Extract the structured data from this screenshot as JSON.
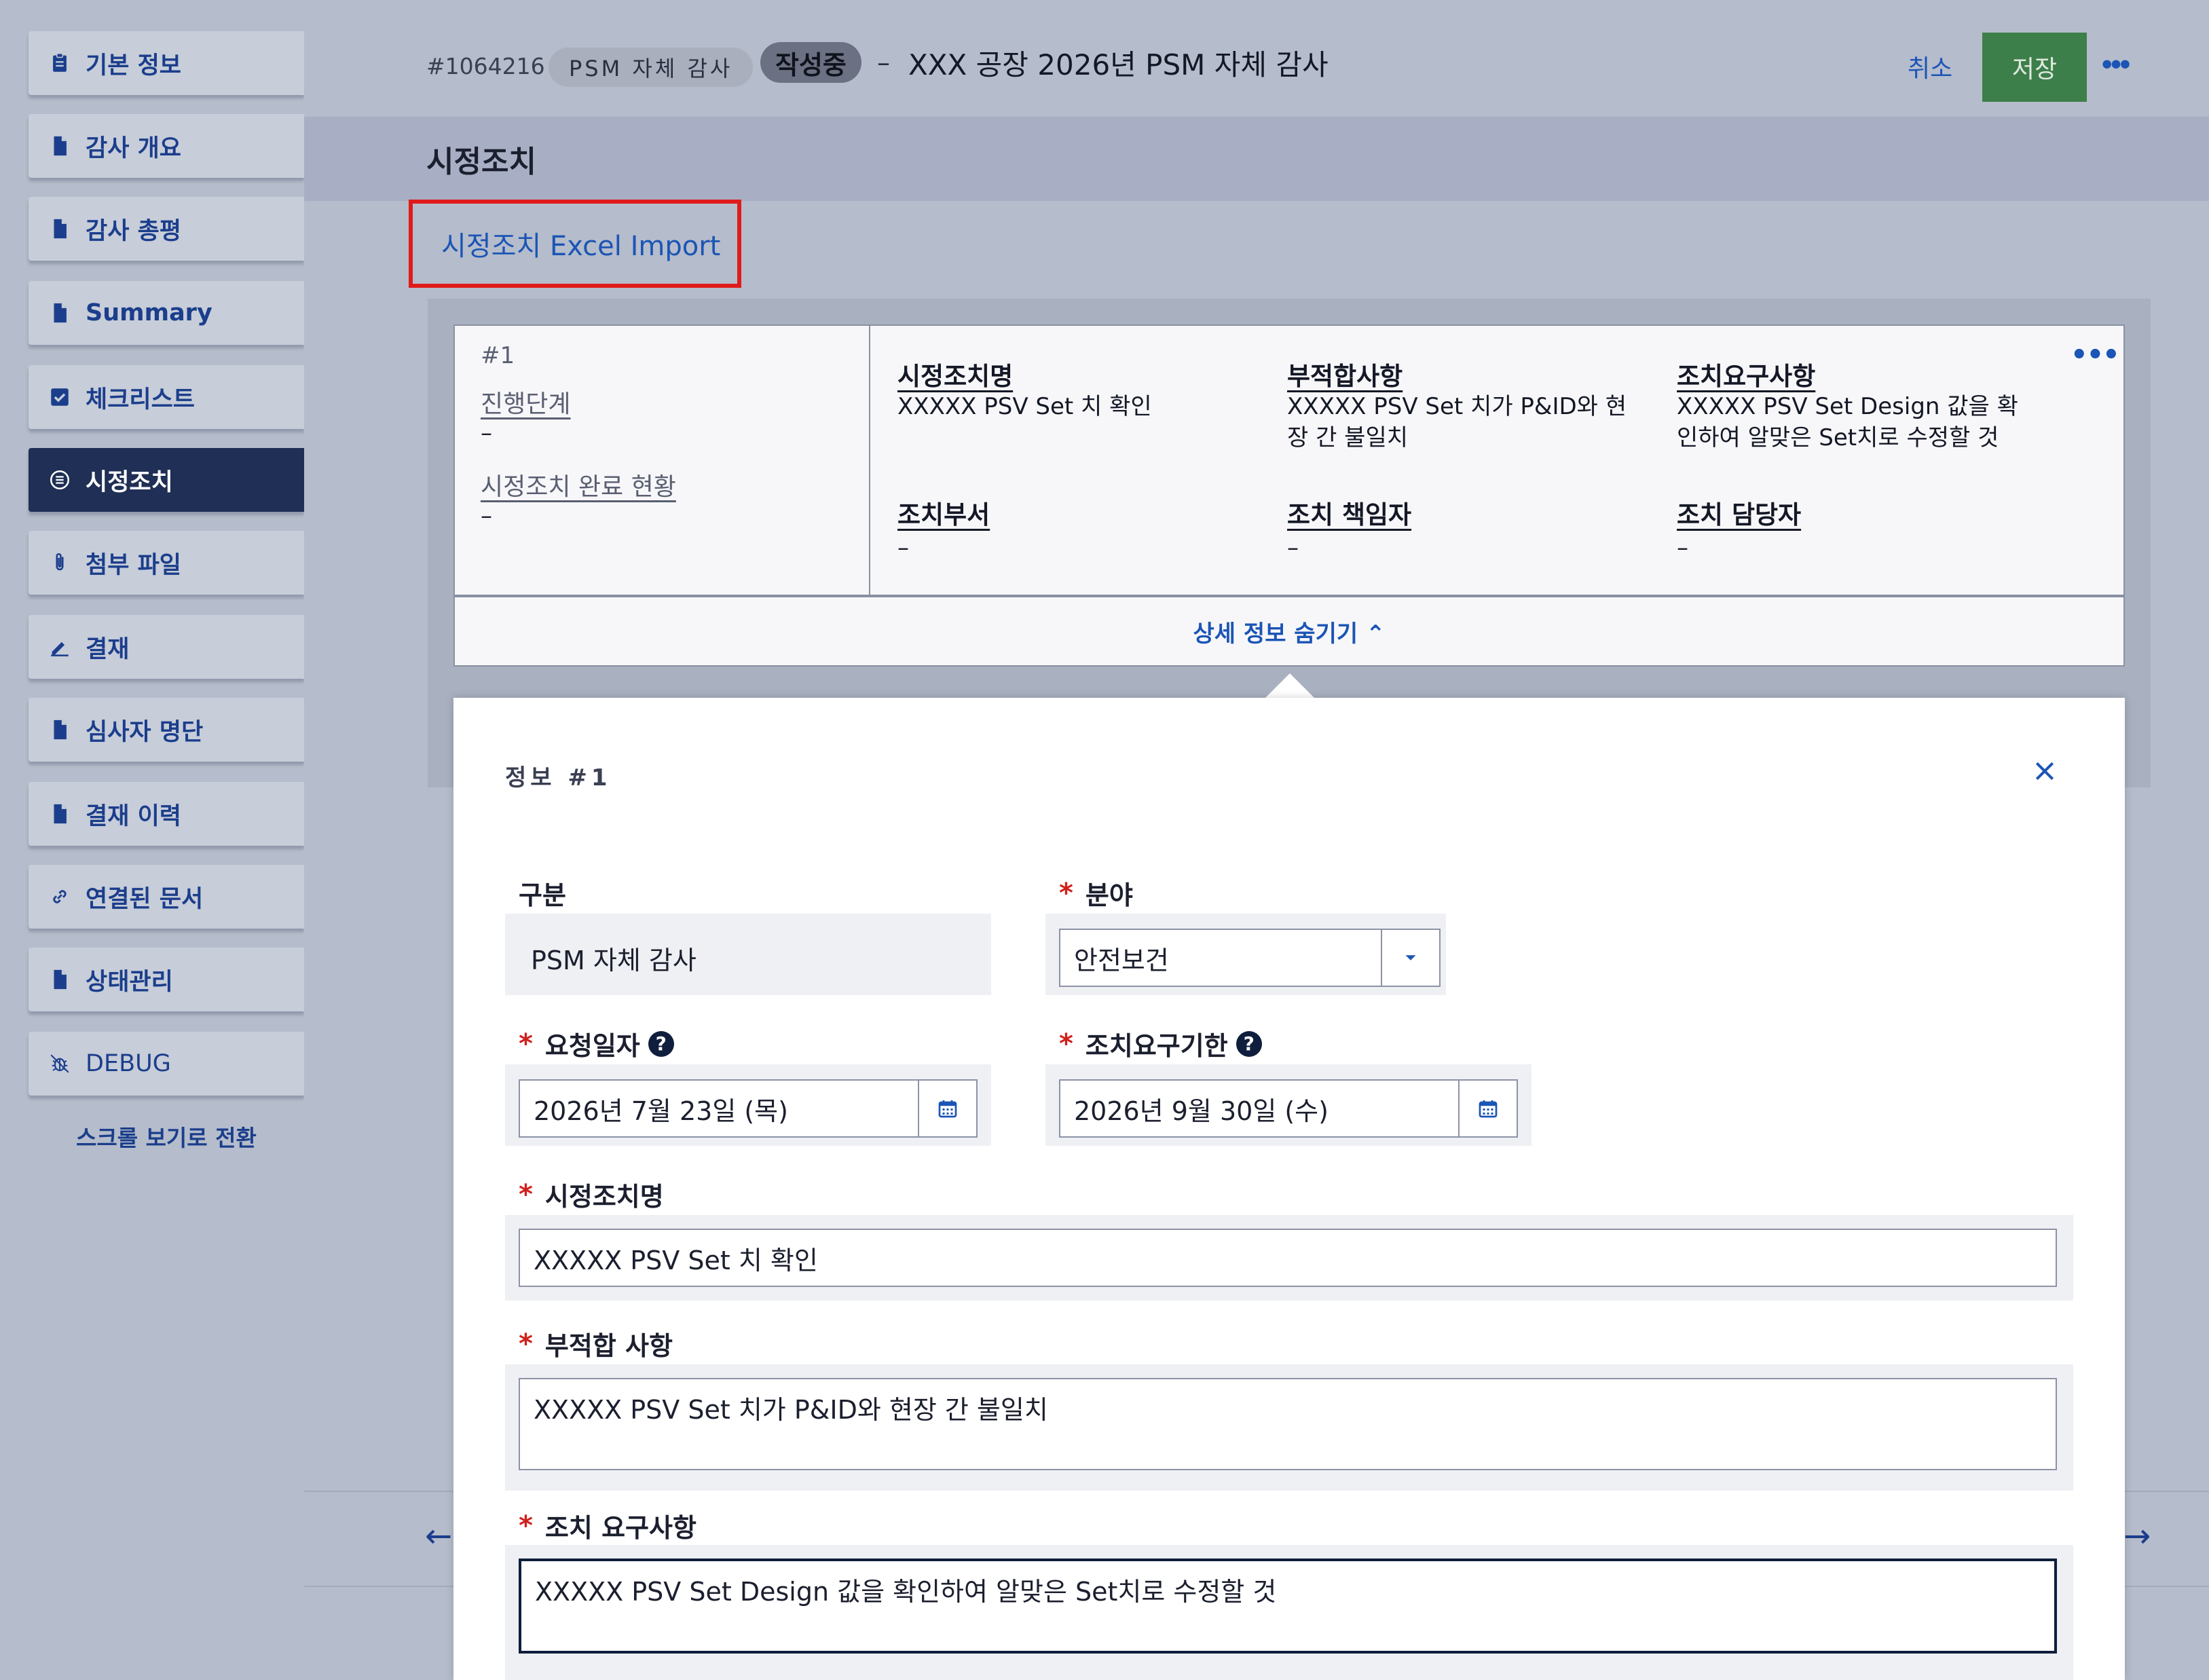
{
  "sidebar": {
    "items": [
      {
        "label": "기본 정보",
        "icon": "clipboard-icon",
        "active": false
      },
      {
        "label": "감사 개요",
        "icon": "document-icon",
        "active": false
      },
      {
        "label": "감사 총평",
        "icon": "document-icon",
        "active": false
      },
      {
        "label": "Summary",
        "icon": "document-icon",
        "active": false
      },
      {
        "label": "체크리스트",
        "icon": "checkbox-icon",
        "active": false
      },
      {
        "label": "시정조치",
        "icon": "list-circle-icon",
        "active": true
      },
      {
        "label": "첨부 파일",
        "icon": "paperclip-icon",
        "active": false
      },
      {
        "label": "결재",
        "icon": "pen-icon",
        "active": false
      },
      {
        "label": "심사자 명단",
        "icon": "document-icon",
        "active": false
      },
      {
        "label": "결재 이력",
        "icon": "document-icon",
        "active": false
      },
      {
        "label": "연결된 문서",
        "icon": "link-icon",
        "active": false
      },
      {
        "label": "상태관리",
        "icon": "document-icon",
        "active": false
      },
      {
        "label": "DEBUG",
        "icon": "bug-icon",
        "active": false
      }
    ],
    "scroll_view_label": "스크롤 보기로 전환"
  },
  "header": {
    "doc_id": "#1064216",
    "type_chip": "PSM 자체 감사",
    "status_chip": "작성중",
    "dash": "–",
    "title": "XXX 공장 2026년 PSM 자체 감사",
    "cancel_label": "취소",
    "save_label": "저장",
    "more_label": "•••"
  },
  "section": {
    "title": "시정조치",
    "import_link": "시정조치 Excel Import"
  },
  "summary_card": {
    "number": "#1",
    "stage_label": "진행단계",
    "stage_value": "–",
    "completion_label": "시정조치 완료 현황",
    "completion_value": "–",
    "name_label": "시정조치명",
    "name_value": "XXXXX PSV Set 치 확인",
    "nonconf_label": "부적합사항",
    "nonconf_value": "XXXXX PSV Set 치가 P&ID와 현장 간 불일치",
    "req_label": "조치요구사항",
    "req_value": "XXXXX PSV Set Design 값을 확인하여 알맞은 Set치로 수정할 것",
    "dept_label": "조치부서",
    "dept_value": "–",
    "owner_label": "조치 책임자",
    "owner_value": "–",
    "assignee_label": "조치 담당자",
    "assignee_value": "–",
    "more_label": "•••",
    "toggle_label": "상세 정보 숨기기 ⌃"
  },
  "detail": {
    "title": "정보 #1",
    "category_label": "구분",
    "category_value": "PSM 자체 감사",
    "field_label": "분야",
    "field_value": "안전보건",
    "request_date_label": "요청일자",
    "request_date_value": "2026년 7월 23일 (목)",
    "due_date_label": "조치요구기한",
    "due_date_value": "2026년 9월 30일 (수)",
    "action_name_label": "시정조치명",
    "action_name_value": "XXXXX PSV Set 치 확인",
    "nonconf_label": "부적합 사항",
    "nonconf_value": "XXXXX PSV Set 치가 P&ID와 현장 간 불일치",
    "requirement_label": "조치 요구사항",
    "requirement_value": "XXXXX PSV Set Design 값을 확인하여 알맞은 Set치로 수정할 것",
    "required_mark": "*",
    "help_mark": "?"
  },
  "colors": {
    "accent": "#1b55b5",
    "save_green": "#3d7f4a",
    "active_nav": "#1f2f55",
    "required_red": "#d0201b",
    "highlight_red": "#e01b1b"
  }
}
